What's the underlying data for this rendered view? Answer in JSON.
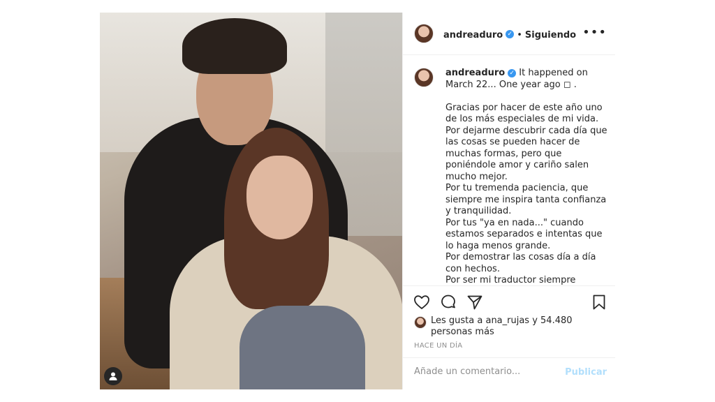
{
  "post": {
    "username": "andreaduro",
    "follow_status": "Siguiendo",
    "separator": "•",
    "more_label": "•••",
    "caption": {
      "username": "andreaduro",
      "text": "It happened on March 22... One year ago ◻ .\n\nGracias por hacer de este año uno de los más especiales de mi vida.\nPor dejarme descubrir cada día que las cosas se pueden hacer de muchas formas, pero que poniéndole amor y cariño salen mucho mejor.\nPor tu tremenda paciencia, que siempre me inspira tanta confianza y tranquilidad.\nPor tus \"ya en nada...\" cuando estamos separados e intentas que lo haga menos grande.\nPor demostrar las cosas día a día con hechos.\nPor ser mi traductor siempre"
    },
    "likes": {
      "text": "Les gusta a ana_rujas y 54.480 personas más"
    },
    "time_ago": "HACE UN DÍA",
    "comment": {
      "placeholder": "Añade un comentario...",
      "publish_label": "Publicar"
    }
  },
  "icons": {
    "like": "heart-icon",
    "comment": "comment-icon",
    "share": "share-icon",
    "save": "bookmark-icon",
    "tag": "user-tag-icon",
    "verified": "verified-badge-icon"
  },
  "colors": {
    "accent": "#3897f0",
    "publish_disabled": "#b2dffc",
    "muted": "#8e8e8e",
    "text": "#262626",
    "divider": "#efefef"
  }
}
